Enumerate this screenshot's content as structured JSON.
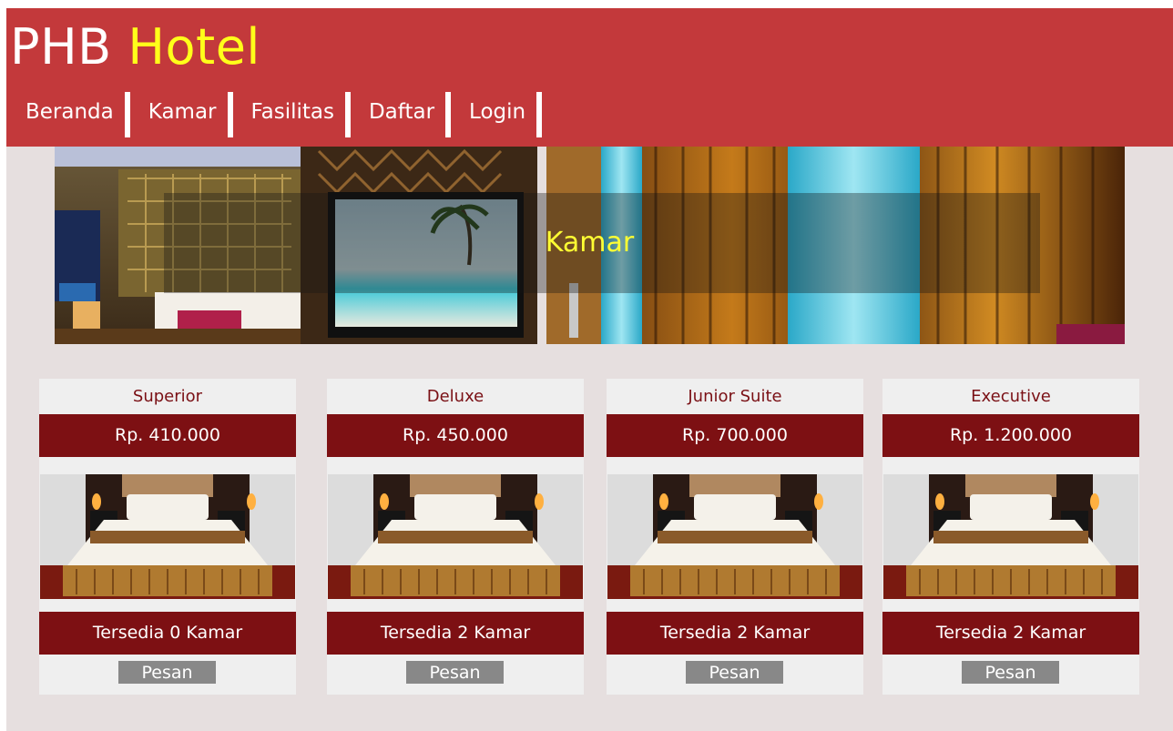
{
  "brand": {
    "part1": "PHB",
    "part2": "Hotel"
  },
  "nav": {
    "items": [
      "Beranda",
      "Kamar",
      "Fasilitas",
      "Daftar",
      "Login"
    ]
  },
  "hero": {
    "title": "Kamar"
  },
  "rooms": [
    {
      "name": "Superior",
      "price": "Rp. 410.000",
      "availability": "Tersedia 0 Kamar",
      "button": "Pesan"
    },
    {
      "name": "Deluxe",
      "price": "Rp. 450.000",
      "availability": "Tersedia 2 Kamar",
      "button": "Pesan"
    },
    {
      "name": "Junior Suite",
      "price": "Rp. 700.000",
      "availability": "Tersedia 2 Kamar",
      "button": "Pesan"
    },
    {
      "name": "Executive",
      "price": "Rp. 1.200.000",
      "availability": "Tersedia 2 Kamar",
      "button": "Pesan"
    }
  ],
  "colors": {
    "header": "#c3393b",
    "brand_accent": "#ffff1a",
    "card_band": "#7d1013",
    "card_title": "#7a1015",
    "button": "#888888",
    "background": "#e6dfdf"
  }
}
